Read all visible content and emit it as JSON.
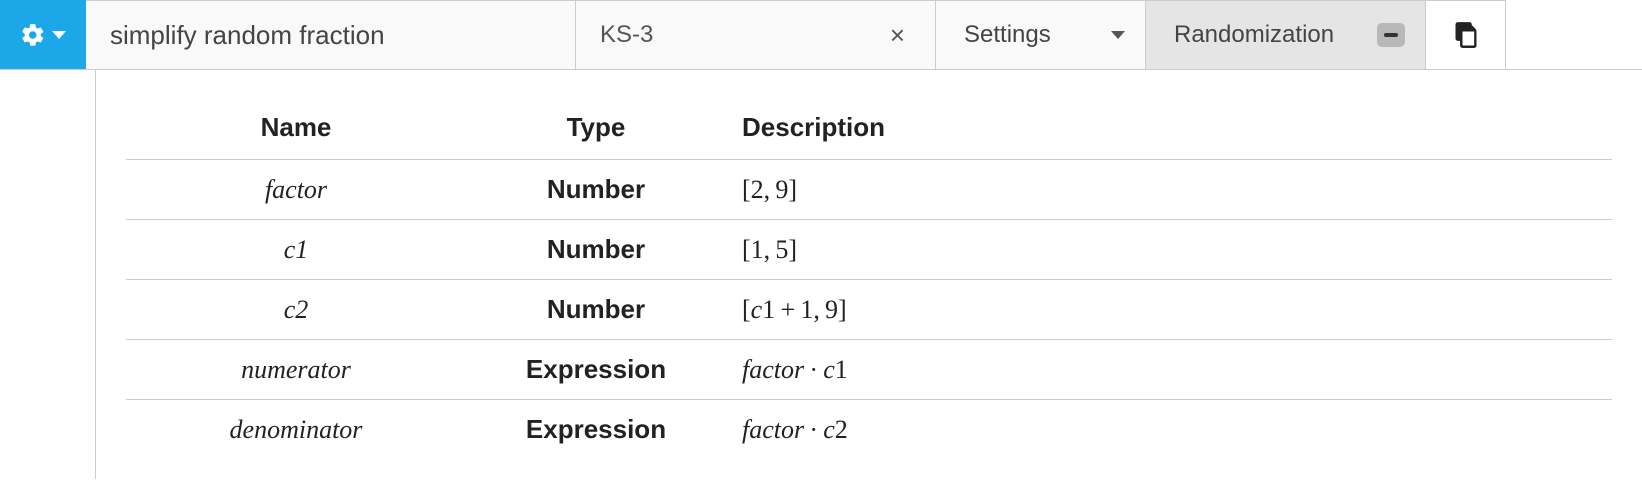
{
  "toolbar": {
    "title": "simplify random fraction",
    "tag": "KS-3",
    "settings_label": "Settings",
    "randomization_label": "Randomization"
  },
  "table": {
    "headers": {
      "name": "Name",
      "type": "Type",
      "desc": "Description"
    },
    "rows": [
      {
        "name": "factor",
        "type": "Number",
        "desc": "[2, 9]"
      },
      {
        "name": "c1",
        "type": "Number",
        "desc": "[1, 5]"
      },
      {
        "name": "c2",
        "type": "Number",
        "desc": "[c1 + 1, 9]"
      },
      {
        "name": "numerator",
        "type": "Expression",
        "desc": "factor · c1"
      },
      {
        "name": "denominator",
        "type": "Expression",
        "desc": "factor · c2"
      }
    ]
  }
}
